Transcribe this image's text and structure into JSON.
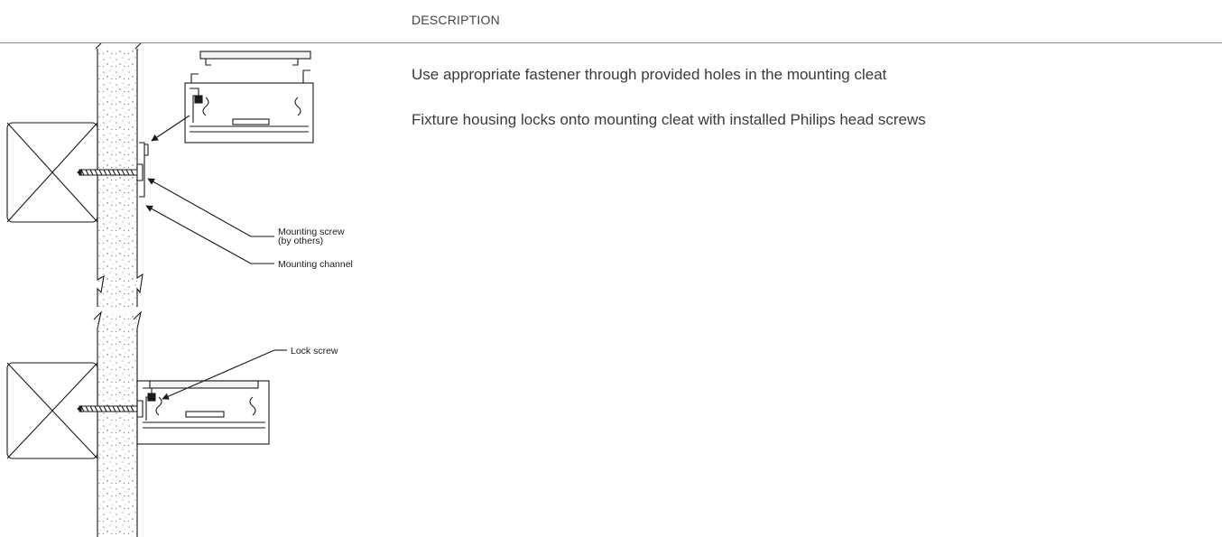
{
  "header": {
    "label": "DESCRIPTION"
  },
  "description": {
    "lines": [
      "Use appropriate fastener through provided holes in the mounting cleat",
      "Fixture housing locks onto mounting cleat with installed Philips head screws"
    ]
  },
  "drawing": {
    "callouts": {
      "mounting_screw_line1": "Mounting screw",
      "mounting_screw_line2": "(by others)",
      "mounting_channel": "Mounting channel",
      "lock_screw": "Lock screw"
    }
  }
}
